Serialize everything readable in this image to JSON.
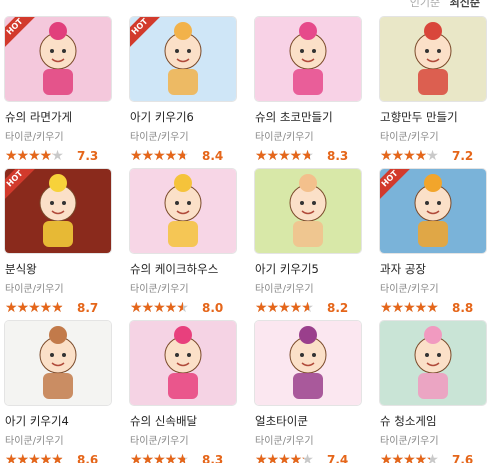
{
  "sort": {
    "option1": "인기순",
    "option2": "최신순"
  },
  "badge_label": "HOT",
  "rating_color": "#e5661a",
  "games": [
    {
      "title": "슈의 라면가게",
      "category": "타이쿤/키우기",
      "score": "7.3",
      "rating": 0.73,
      "hot": true,
      "bg": "#f4c8dc",
      "accent": "#e13f7c"
    },
    {
      "title": "아기 키우기6",
      "category": "타이쿤/키우기",
      "score": "8.4",
      "rating": 0.84,
      "hot": true,
      "bg": "#cfe6f7",
      "accent": "#f2b24a"
    },
    {
      "title": "슈의 초코만들기",
      "category": "타이쿤/키우기",
      "score": "8.3",
      "rating": 0.83,
      "hot": false,
      "bg": "#f8d2e6",
      "accent": "#e64a8b"
    },
    {
      "title": "고향만두 만들기",
      "category": "타이쿤/키우기",
      "score": "7.2",
      "rating": 0.72,
      "hot": false,
      "bg": "#e9e7c7",
      "accent": "#d9463b"
    },
    {
      "title": "분식왕",
      "category": "타이쿤/키우기",
      "score": "8.7",
      "rating": 0.87,
      "hot": true,
      "bg": "#8a2a1c",
      "accent": "#f7d23a"
    },
    {
      "title": "슈의 케이크하우스",
      "category": "타이쿤/키우기",
      "score": "8.0",
      "rating": 0.8,
      "hot": false,
      "bg": "#f7d6e6",
      "accent": "#f5c33b"
    },
    {
      "title": "아기 키우기5",
      "category": "타이쿤/키우기",
      "score": "8.2",
      "rating": 0.82,
      "hot": false,
      "bg": "#d8e8a8",
      "accent": "#f3c08c"
    },
    {
      "title": "과자 공장",
      "category": "타이쿤/키우기",
      "score": "8.8",
      "rating": 0.88,
      "hot": true,
      "bg": "#7ab3d9",
      "accent": "#f2a52b"
    },
    {
      "title": "아기 키우기4",
      "category": "타이쿤/키우기",
      "score": "8.6",
      "rating": 0.86,
      "hot": false,
      "bg": "#f4f4f2",
      "accent": "#c27a4a"
    },
    {
      "title": "슈의 신속배달",
      "category": "타이쿤/키우기",
      "score": "8.3",
      "rating": 0.83,
      "hot": false,
      "bg": "#f5d3e4",
      "accent": "#e8407d"
    },
    {
      "title": "얼초타이쿤",
      "category": "타이쿤/키우기",
      "score": "7.4",
      "rating": 0.74,
      "hot": false,
      "bg": "#fbe7f0",
      "accent": "#9a3f8c"
    },
    {
      "title": "슈 청소게임",
      "category": "타이쿤/키우기",
      "score": "7.6",
      "rating": 0.76,
      "hot": false,
      "bg": "#c9e4d6",
      "accent": "#f19ac0"
    }
  ]
}
